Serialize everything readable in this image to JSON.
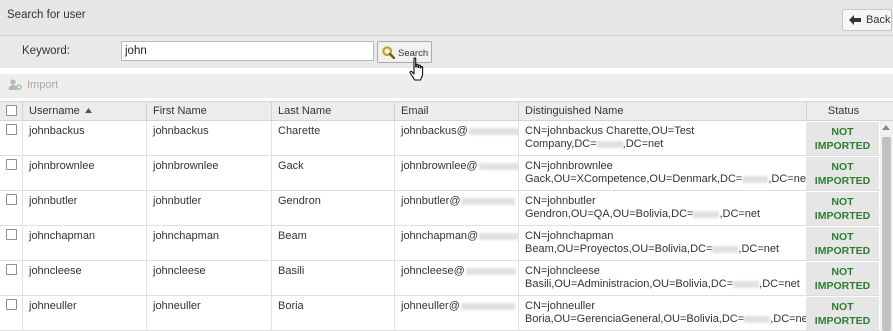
{
  "header": {
    "title": "Search for user",
    "back_label": "Back",
    "back_icon": "arrow-left-icon"
  },
  "search": {
    "keyword_label": "Keyword:",
    "keyword_value": "john",
    "button_label": "Search",
    "button_icon": "magnifier-icon"
  },
  "toolbar": {
    "import_label": "Import",
    "import_icon": "users-import-icon"
  },
  "table": {
    "columns": [
      "Username",
      "First Name",
      "Last Name",
      "Email",
      "Distinguished Name",
      "Status"
    ],
    "sort_column": "Username",
    "sort_direction": "ascending",
    "rows": [
      {
        "username": "johnbackus",
        "first": "johnbackus",
        "last": "Charette",
        "email": "johnbackus@",
        "dn1": "CN=johnbackus Charette,OU=Test",
        "dn2a": "Company,DC=",
        "dn2b": ",DC=net",
        "status1": "NOT",
        "status2": "IMPORTED"
      },
      {
        "username": "johnbrownlee",
        "first": "johnbrownlee",
        "last": "Gack",
        "email": "johnbrownlee@",
        "dn1": "CN=johnbrownlee",
        "dn2a": "Gack,OU=XCompetence,OU=Denmark,DC=",
        "dn2b": ",DC=net",
        "status1": "NOT",
        "status2": "IMPORTED"
      },
      {
        "username": "johnbutler",
        "first": "johnbutler",
        "last": "Gendron",
        "email": "johnbutler@",
        "dn1": "CN=johnbutler",
        "dn2a": "Gendron,OU=QA,OU=Bolivia,DC=",
        "dn2b": ",DC=net",
        "status1": "NOT",
        "status2": "IMPORTED"
      },
      {
        "username": "johnchapman",
        "first": "johnchapman",
        "last": "Beam",
        "email": "johnchapman@",
        "dn1": "CN=johnchapman",
        "dn2a": "Beam,OU=Proyectos,OU=Bolivia,DC=",
        "dn2b": ",DC=net",
        "status1": "NOT",
        "status2": "IMPORTED"
      },
      {
        "username": "johncleese",
        "first": "johncleese",
        "last": "Basili",
        "email": "johncleese@",
        "dn1": "CN=johncleese",
        "dn2a": "Basili,OU=Administracion,OU=Bolivia,DC=",
        "dn2b": ",DC=net",
        "status1": "NOT",
        "status2": "IMPORTED"
      },
      {
        "username": "johneuller",
        "first": "johneuller",
        "last": "Boria",
        "email": "johneuller@",
        "dn1": "CN=johneuller",
        "dn2a": "Boria,OU=GerenciaGeneral,OU=Bolivia,DC=",
        "dn2b": ",DC=net",
        "status1": "NOT",
        "status2": "IMPORTED"
      }
    ]
  },
  "colors": {
    "status_text": "#2e7d32",
    "header_bg": "#e6e6e6",
    "status_cell_bg": "#e6e6e6"
  }
}
